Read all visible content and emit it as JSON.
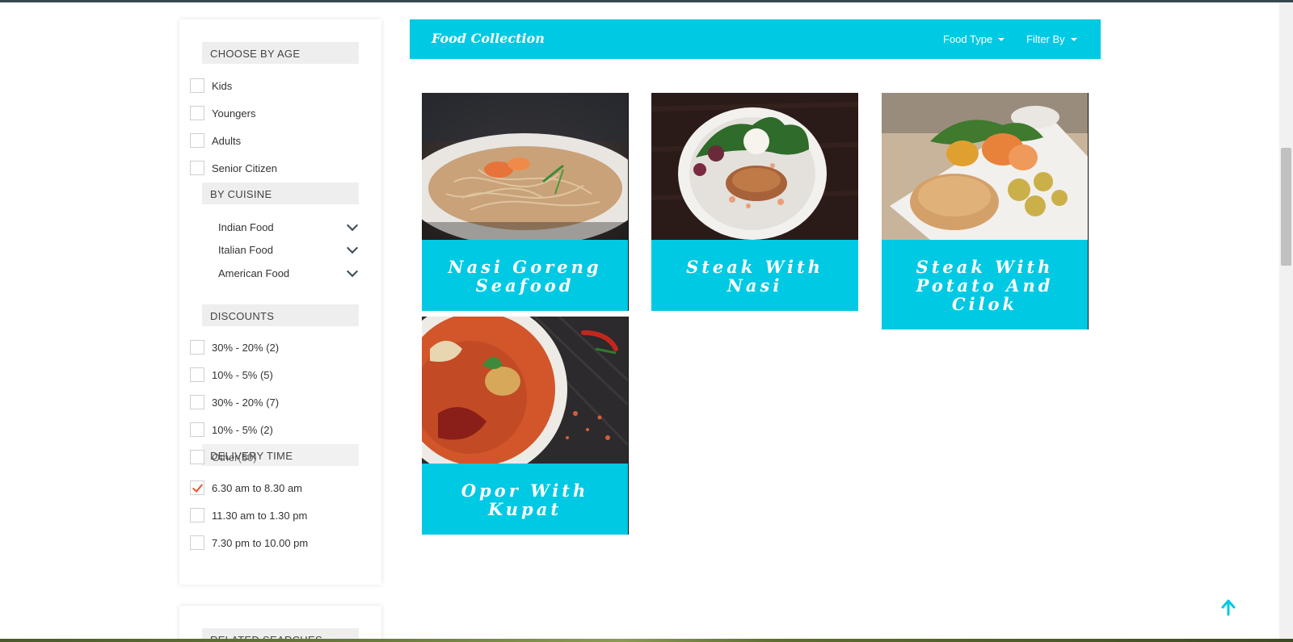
{
  "header": {
    "brand": "Food Collection",
    "food_type_label": "Food Type",
    "filter_by_label": "Filter By"
  },
  "sidebar": {
    "age": {
      "title": "CHOOSE BY AGE",
      "items": [
        {
          "label": "Kids",
          "checked": false
        },
        {
          "label": "Youngers",
          "checked": false
        },
        {
          "label": "Adults",
          "checked": false
        },
        {
          "label": "Senior Citizen",
          "checked": false
        }
      ]
    },
    "cuisine": {
      "title": "BY CUISINE",
      "items": [
        {
          "label": "Indian Food"
        },
        {
          "label": "Italian Food"
        },
        {
          "label": "American Food"
        }
      ]
    },
    "discounts": {
      "title": "DISCOUNTS",
      "items": [
        {
          "label": "30% - 20% (2)",
          "checked": false
        },
        {
          "label": "10% - 5% (5)",
          "checked": false
        },
        {
          "label": "30% - 20% (7)",
          "checked": false
        },
        {
          "label": "10% - 5% (2)",
          "checked": false
        },
        {
          "label": "Other(50)",
          "checked": false
        }
      ]
    },
    "delivery": {
      "title": "DELIVERY TIME",
      "items": [
        {
          "label": "6.30 am to 8.30 am",
          "checked": true
        },
        {
          "label": "11.30 am to 1.30 pm",
          "checked": false
        },
        {
          "label": "7.30 pm to 10.00 pm",
          "checked": false
        }
      ]
    },
    "related": {
      "title": "RELATED SEARCHES"
    }
  },
  "cards": [
    {
      "title": "Nasi Goreng Seafood"
    },
    {
      "title": "Steak With Nasi"
    },
    {
      "title": "Steak With Potato And Cilok"
    },
    {
      "title": "Opor With Kupat"
    }
  ],
  "colors": {
    "accent": "#00c9e4",
    "check": "#e8562a",
    "section_bg": "#eeeeee"
  },
  "icons": {
    "back_to_top": "arrow-up-icon",
    "expand": "chevron-down-icon"
  }
}
